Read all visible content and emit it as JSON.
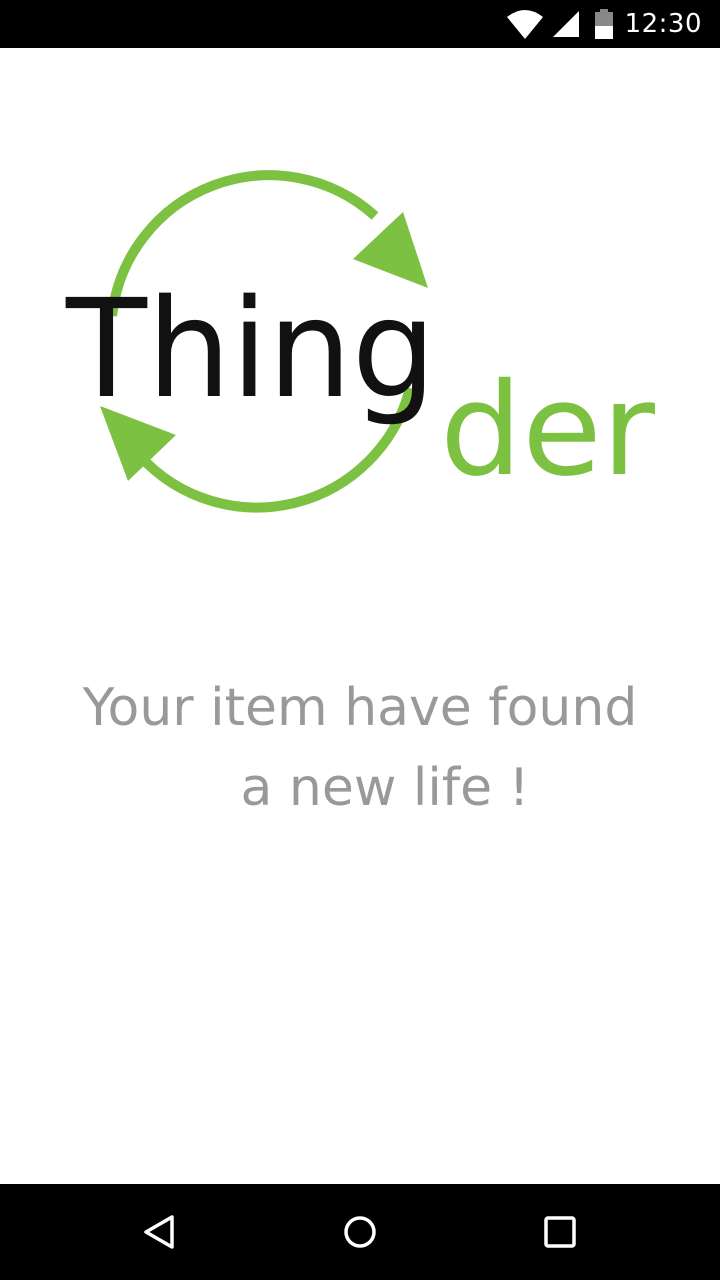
{
  "status_bar": {
    "time": "12:30",
    "icons": [
      "wifi-icon",
      "cell-signal-icon",
      "battery-icon"
    ]
  },
  "logo": {
    "word_primary": "Thing",
    "word_accent": "der",
    "primary_color": "#111111",
    "accent_color": "#7DC142"
  },
  "message": {
    "line1": "Your item have found",
    "line2": "a new life !",
    "color": "#999999"
  },
  "nav_bar": {
    "buttons": [
      "back-icon",
      "home-icon",
      "recents-icon"
    ]
  }
}
